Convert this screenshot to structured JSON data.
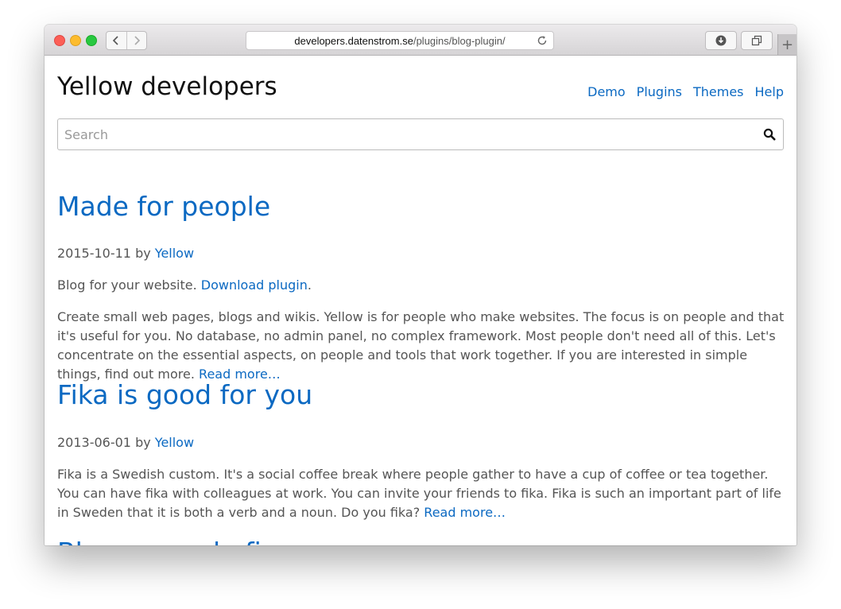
{
  "browser": {
    "url_domain": "developers.datenstrom.se",
    "url_path": "/plugins/blog-plugin/"
  },
  "site": {
    "title": "Yellow developers",
    "nav": [
      "Demo",
      "Plugins",
      "Themes",
      "Help"
    ],
    "search_placeholder": "Search"
  },
  "posts": [
    {
      "title": "Made for people",
      "date": "2015-10-11",
      "by": "by",
      "author": "Yellow",
      "intro_text": "Blog for your website.",
      "intro_link": "Download plugin",
      "intro_end": ".",
      "body": "Create small web pages, blogs and wikis. Yellow is for people who make websites. The focus is on people and that it's useful for you. No database, no admin panel, no complex framework. Most people don't need all of this. Let's concentrate on the essential aspects, on people and tools that work together. If you are interested in simple things, find out more.",
      "read_more": "Read more…"
    },
    {
      "title": "Fika is good for you",
      "date": "2013-06-01",
      "by": "by",
      "author": "Yellow",
      "body": "Fika is a Swedish custom. It's a social coffee break where people gather to have a cup of coffee or tea together. You can have fika with colleagues at work. You can invite your friends to fika. Fika is such an important part of life in Sweden that it is both a verb and a noun. Do you fika?",
      "read_more": "Read more…"
    },
    {
      "title": "Blog example five"
    }
  ],
  "colors": {
    "link": "#0b69c2",
    "text": "#555555",
    "title": "#111111"
  }
}
